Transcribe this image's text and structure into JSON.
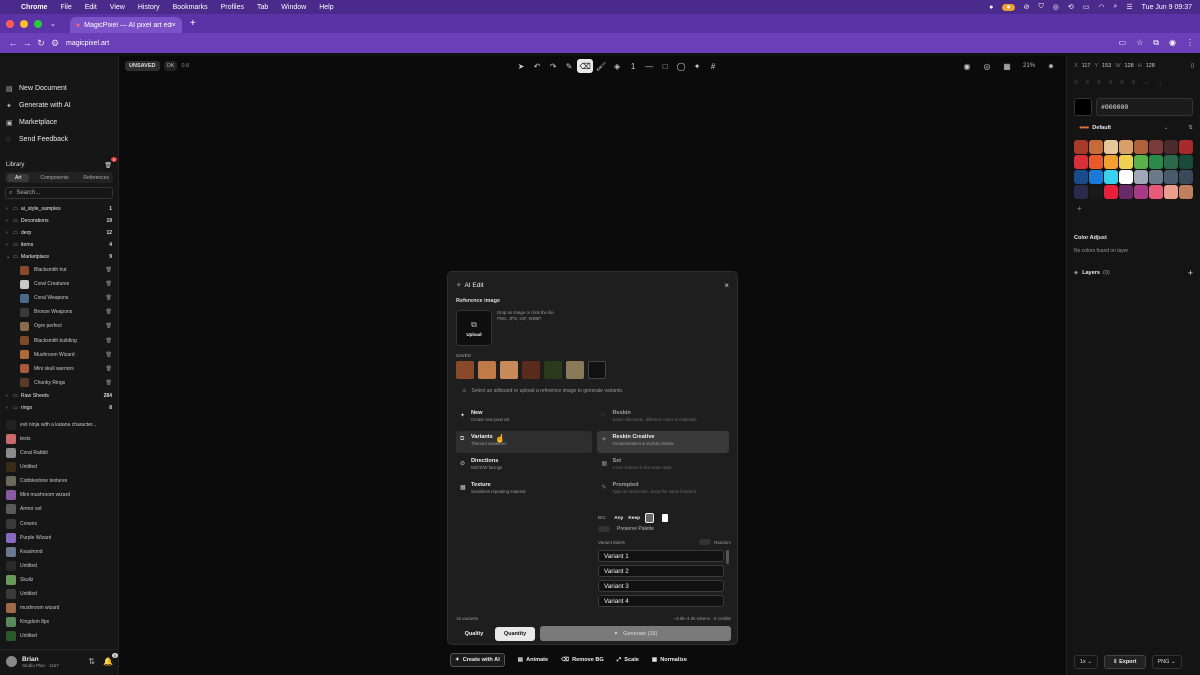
{
  "mac": {
    "menu": [
      "Chrome",
      "File",
      "Edit",
      "View",
      "History",
      "Bookmarks",
      "Profiles",
      "Tab",
      "Window",
      "Help"
    ],
    "clock": "Tue Jun 9  09:37"
  },
  "browser": {
    "tab_title": "MagicPixel — AI pixel art edit",
    "url": "magicpixel.art"
  },
  "sidebar": {
    "menu": [
      {
        "icon": "new-document-icon",
        "label": "New Document"
      },
      {
        "icon": "generate-icon",
        "label": "Generate with AI"
      },
      {
        "icon": "marketplace-icon",
        "label": "Marketplace"
      },
      {
        "icon": "feedback-icon",
        "label": "Send Feedback"
      }
    ],
    "library_title": "Library",
    "library_badge": "6",
    "tabs": [
      "Art",
      "Components",
      "References"
    ],
    "search_placeholder": "Search...",
    "folders_top": [
      {
        "name": "ai_style_samples",
        "count": "1"
      },
      {
        "name": "Decorations",
        "count": "19"
      },
      {
        "name": "derp",
        "count": "12"
      },
      {
        "name": "items",
        "count": "4"
      },
      {
        "name": "Marketplace",
        "count": "9"
      }
    ],
    "marketplace_items": [
      "Blacksmith hut",
      "Coral Creatures",
      "Coral Weapons",
      "Bronze Weapons",
      "Ogre perfect",
      "Blacksmith building",
      "Mushroom Wizard",
      "Mini skull warriors",
      "Chunky Rings"
    ],
    "folders_bottom": [
      {
        "name": "Raw Sheets",
        "count": "284"
      },
      {
        "name": "rings",
        "count": "8"
      }
    ],
    "docs": [
      "evil ninja with a katana character...",
      "tests",
      "Coral Rabbit",
      "Untitled",
      "Cobblestone textures",
      "Mini mushroom wizard",
      "Armor set",
      "Crowns",
      "Purple Wizard",
      "Keashond",
      "Untitled",
      "Skullz",
      "Untitled",
      "mushroom wizard",
      "Kingdom 8px",
      "Untitled"
    ],
    "user": {
      "name": "Brian",
      "plan": "Studio Plan · 1167",
      "badge": "5"
    }
  },
  "topbar": {
    "unsaved": "UNSAVED",
    "ok": "OK",
    "version": "0.8",
    "zoom": "21%",
    "active_tool": "eraser-icon",
    "brush_size": "1"
  },
  "right": {
    "x": "117",
    "y": "153",
    "w": "128",
    "h": "128",
    "hex": "#000000",
    "palette_name": "Default",
    "swatches": [
      "#a83a2a",
      "#c76a3a",
      "#e7c79a",
      "#d9a06a",
      "#b0603a",
      "#7a3a3a",
      "#4a2a2a",
      "#a82a2a",
      "#d8303a",
      "#e85a2a",
      "#f0a030",
      "#f0d050",
      "#5ab04a",
      "#2a8a4a",
      "#2a6a4a",
      "#1a4a3a",
      "#1a4a8a",
      "#1a7ad8",
      "#3ad0f0",
      "#ffffff",
      "#a0a8b8",
      "#6a7a8a",
      "#4a5a6a",
      "#3a4a5a",
      "#2a2a4a",
      "#1a1a1a",
      "#e8203a",
      "#6a2a6a",
      "#a83a8a",
      "#e85a7a",
      "#e8a08a",
      "#c08060"
    ],
    "color_adjust_title": "Color Adjust",
    "color_adjust_empty": "No colors found on layer",
    "layers_label": "Layers",
    "layers_count": "(0)",
    "scale": "1x",
    "export": "Export",
    "format": "PNG"
  },
  "modal": {
    "title": "AI Edit",
    "reference_label": "Reference image",
    "upload": "Upload",
    "drop_text": "Drop an image or click the tile.",
    "formats": "PNG, JPG, GIF, WEBP.",
    "saved_label": "SAVED",
    "hint": "Select an artboard or upload a reference image to generate variants.",
    "modes_left": [
      {
        "title": "New",
        "sub": "Create new pixel art",
        "icon": "sparkle-icon"
      },
      {
        "title": "Variants",
        "sub": "Themed variations",
        "icon": "copy-icon"
      },
      {
        "title": "Directions",
        "sub": "N/E/S/W facings",
        "icon": "compass-icon"
      },
      {
        "title": "Texture",
        "sub": "Seamless repeating material",
        "icon": "texture-icon"
      }
    ],
    "modes_right": [
      {
        "title": "Reskin",
        "sub": "Same silhouette, different colors & materials",
        "icon": "palette-icon"
      },
      {
        "title": "Reskin Creative",
        "sub": "Ornamentation & stylistic details",
        "icon": "sparkles-icon"
      },
      {
        "title": "Set",
        "sub": "A set of items in the same style",
        "icon": "grid-icon"
      },
      {
        "title": "Prompted",
        "sub": "Type an instruction, keep the same footprint",
        "icon": "pen-icon"
      }
    ],
    "bg_label": "BG:",
    "bg_any": "Any",
    "bg_keep": "Keep",
    "preserve": "Preserve Palette",
    "variant_labels": "Variant labels",
    "random": "Random",
    "variants": [
      "Variant 1",
      "Variant 2",
      "Variant 3",
      "Variant 4"
    ],
    "count": "15 variants",
    "cost": "~3.0k–4.5k tokens · 8 credits",
    "quality": "Quality",
    "quantity": "Quantity",
    "generate": "Generate (15)"
  },
  "bottom": [
    {
      "icon": "sparkle-icon",
      "label": "Create with AI"
    },
    {
      "icon": "film-icon",
      "label": "Animate"
    },
    {
      "icon": "eraser-icon",
      "label": "Remove BG"
    },
    {
      "icon": "scale-icon",
      "label": "Scale"
    },
    {
      "icon": "normalize-icon",
      "label": "Normalize"
    }
  ]
}
